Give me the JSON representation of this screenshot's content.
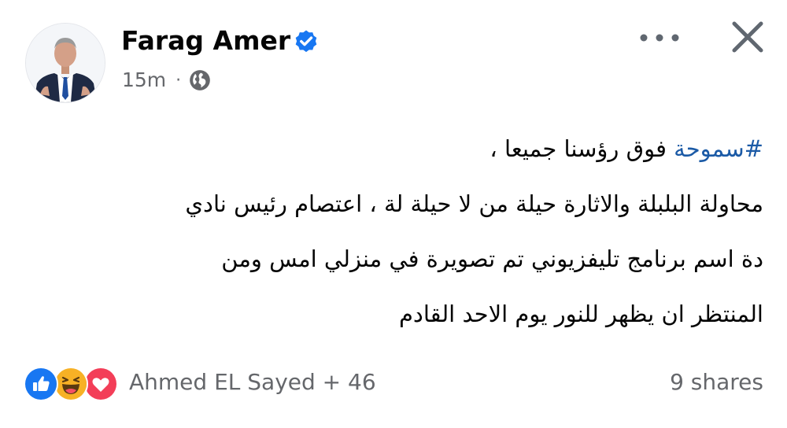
{
  "post": {
    "author": "Farag Amer",
    "time": "15m",
    "separator": "·",
    "privacy_icon": "globe-icon",
    "verified_icon": "verified-badge-icon",
    "more_icon": "more-options-icon",
    "close_icon": "close-icon",
    "content": {
      "hashtag": "#سموحة",
      "line1_rest": " فوق رؤسنا جميعا ،",
      "line2": "محاولة البلبلة والاثارة حيلة من لا حيلة لة ، اعتصام رئيس نادي",
      "line3": "دة اسم برنامج تليفزيوني تم تصويرة في منزلي   امس ومن",
      "line4": "المنتظر ان يظهر للنور يوم الاحد القادم"
    },
    "reactions": {
      "icons": [
        "like-icon",
        "haha-icon",
        "love-icon"
      ],
      "summary": "Ahmed EL Sayed + 46",
      "shares": "9 shares"
    },
    "colors": {
      "accent": "#1877f2",
      "hashtag": "#1b5aa6",
      "secondary_text": "#65676b",
      "love": "#f33e58",
      "haha": "#f7b125"
    }
  }
}
